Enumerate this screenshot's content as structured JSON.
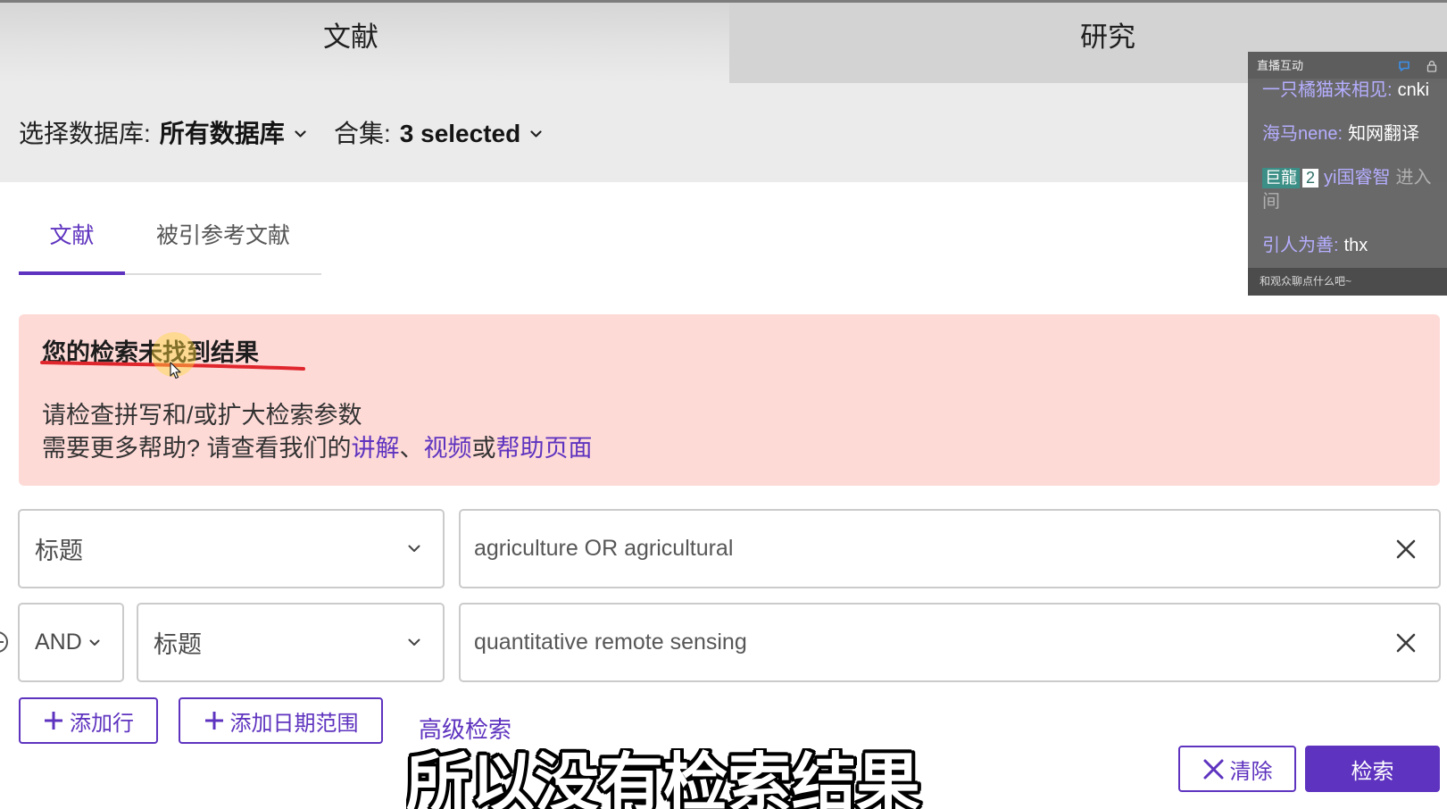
{
  "top_tabs": [
    {
      "label": "文献",
      "active": true
    },
    {
      "label": "研究",
      "active": false
    }
  ],
  "database_bar": {
    "database_label": "选择数据库:",
    "database_value": "所有数据库",
    "collection_label": "合集:",
    "collection_value": "3 selected"
  },
  "result_tabs": [
    {
      "label": "文献",
      "active": true
    },
    {
      "label": "被引参考文献",
      "active": false
    }
  ],
  "alert": {
    "title": "您的检索未找到结果",
    "message": "请检查拼写和/或扩大检索参数",
    "help_prefix": "需要更多帮助? 请查看我们的",
    "help_link_tutorial": "讲解",
    "help_separator_1": "、",
    "help_link_video": "视频",
    "help_separator_2": "或",
    "help_link_help_page": "帮助页面"
  },
  "search_rows": [
    {
      "field": "标题",
      "query": "agriculture OR agricultural"
    },
    {
      "operator": "AND",
      "field": "标题",
      "query": "quantitative remote sensing"
    }
  ],
  "actions": {
    "add_row": "添加行",
    "add_date_range": "添加日期范围",
    "advanced_search": "高级检索",
    "clear": "清除",
    "search": "检索"
  },
  "live_chat": {
    "title": "直播互动",
    "messages": [
      {
        "user": "一只橘猫来相见:",
        "text": "cnki"
      },
      {
        "user": "海马nene:",
        "text": "知网翻译"
      },
      {
        "badge": "巨龍",
        "badge_level": "2",
        "user": "yi国睿智",
        "text": "进入",
        "text_line2": "间"
      },
      {
        "user": "引人为善:",
        "text": "thx"
      }
    ],
    "input_placeholder": "和观众聊点什么吧~"
  },
  "subtitle": "所以没有检索结果",
  "colors": {
    "brand_purple": "#5e33bf",
    "alert_background": "#fedad7",
    "annotation_red": "#e0262d",
    "cursor_highlight": "#ffd63c",
    "chat_username": "#b5aeff",
    "chat_badge": "#3b8f86"
  },
  "icons": {
    "dropdown": "chevron-down-icon",
    "clear_field": "close-icon",
    "add": "plus-icon",
    "remove_row": "minus-circle-icon",
    "chat_bubble": "bubble-icon",
    "chat_lock": "lock-icon"
  }
}
